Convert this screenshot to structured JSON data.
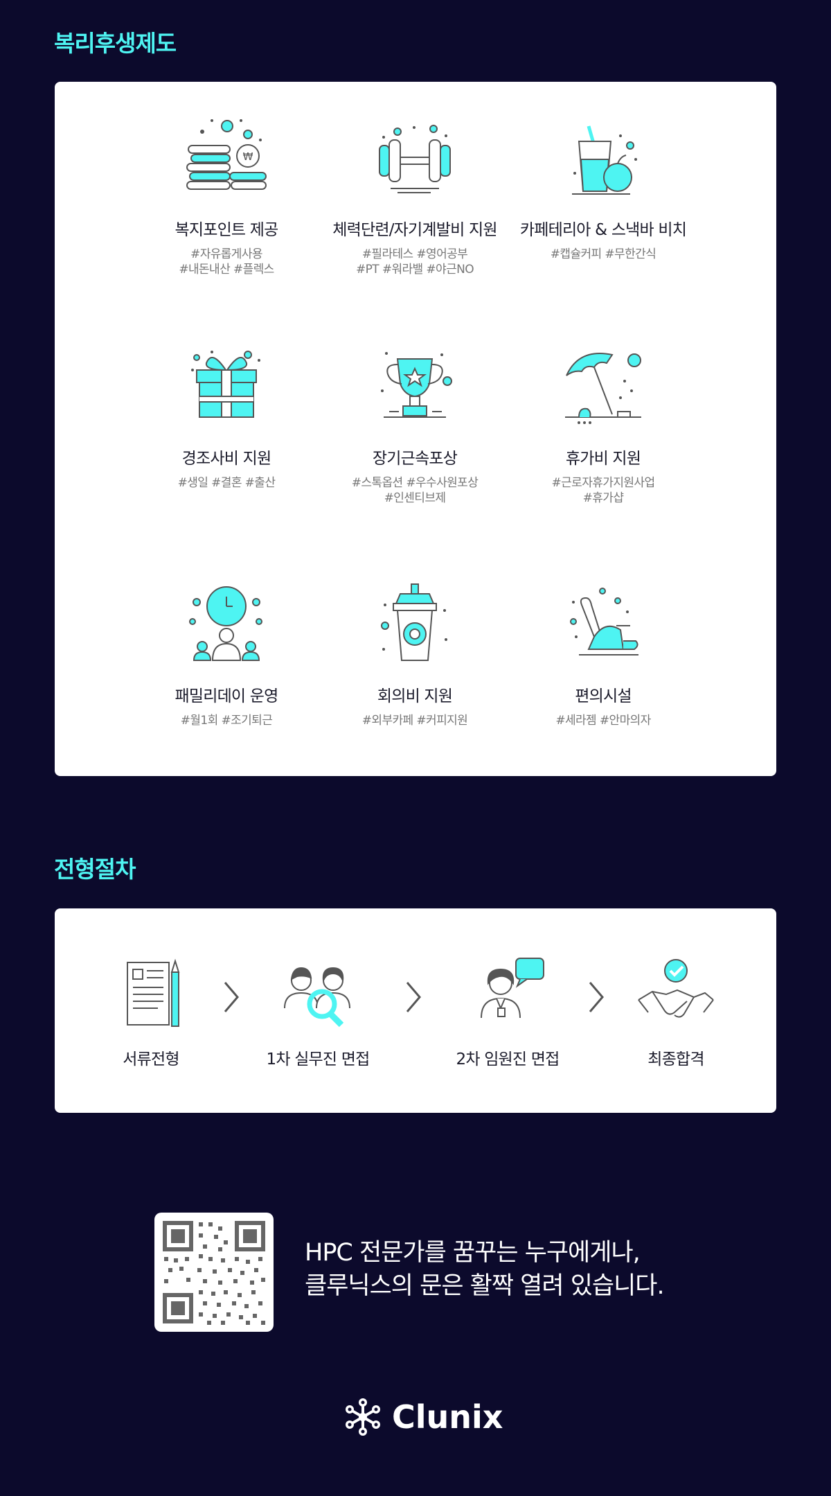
{
  "benefits_section": {
    "title": "복리후생제도",
    "items": [
      {
        "name": "복지포인트 제공",
        "tags": [
          "#자유롭게사용",
          "#내돈내산 #플렉스"
        ],
        "icon": "coin-stack-icon"
      },
      {
        "name": "체력단련/자기계발비 지원",
        "tags": [
          "#필라테스 #영어공부",
          "#PT #워라밸 #야근NO"
        ],
        "icon": "dumbbell-icon"
      },
      {
        "name": "카페테리아 & 스낵바 비치",
        "tags": [
          "#캡슐커피 #무한간식"
        ],
        "icon": "drink-icon"
      },
      {
        "name": "경조사비 지원",
        "tags": [
          "#생일 #결혼 #출산"
        ],
        "icon": "gift-icon"
      },
      {
        "name": "장기근속포상",
        "tags": [
          "#스톡옵션 #우수사원포상",
          "#인센티브제"
        ],
        "icon": "trophy-icon"
      },
      {
        "name": "휴가비 지원",
        "tags": [
          "#근로자휴가지원사업",
          "#휴가샵"
        ],
        "icon": "beach-umbrella-icon"
      },
      {
        "name": "패밀리데이 운영",
        "tags": [
          "#월1회 #조기퇴근"
        ],
        "icon": "family-clock-icon"
      },
      {
        "name": "회의비 지원",
        "tags": [
          "#외부카페 #커피지원"
        ],
        "icon": "coffee-cup-icon"
      },
      {
        "name": "편의시설",
        "tags": [
          "#세라젬 #안마의자"
        ],
        "icon": "massage-chair-icon"
      }
    ]
  },
  "process_section": {
    "title": "전형절차",
    "steps": [
      {
        "label": "서류전형",
        "icon": "document-pencil-icon"
      },
      {
        "label": "1차 실무진 면접",
        "icon": "interviewers-search-icon"
      },
      {
        "label": "2차 임원진 면접",
        "icon": "executive-chat-icon"
      },
      {
        "label": "최종합격",
        "icon": "handshake-check-icon"
      }
    ]
  },
  "footer": {
    "slogan_line1": "HPC 전문가를 꿈꾸는 누구에게나,",
    "slogan_line2": "클루닉스의 문은 활짝 열려 있습니다.",
    "logo_text": "Clunix"
  },
  "colors": {
    "background": "#0c0a2c",
    "accent": "#4ef4f2",
    "card": "#ffffff",
    "icon_stroke": "#555555"
  }
}
